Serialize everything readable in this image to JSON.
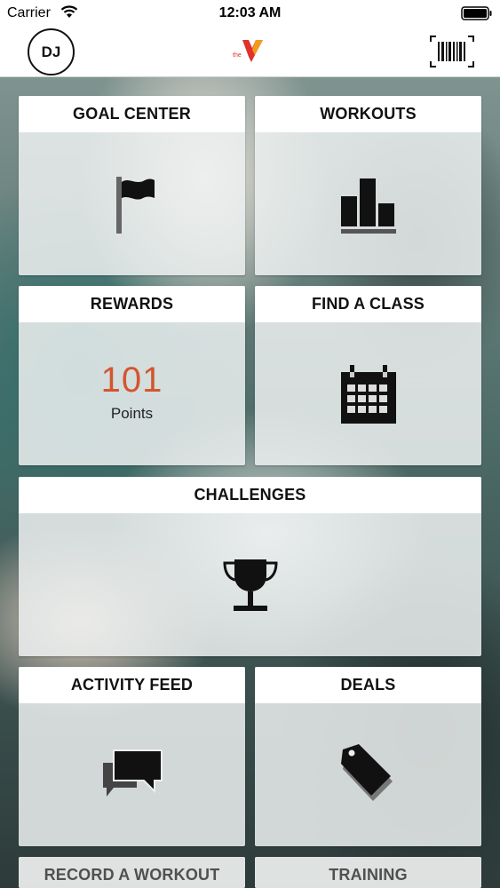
{
  "status_bar": {
    "carrier": "Carrier",
    "time": "12:03 AM",
    "icons": [
      "wifi-icon",
      "battery-icon"
    ]
  },
  "nav": {
    "avatar_initials": "DJ",
    "logo_text": "the",
    "icons": [
      "ymca-logo",
      "barcode-icon"
    ]
  },
  "tiles": {
    "goal_center": {
      "title": "GOAL CENTER",
      "icon": "flag-icon"
    },
    "workouts": {
      "title": "WORKOUTS",
      "icon": "bar-chart-icon"
    },
    "rewards": {
      "title": "REWARDS",
      "points_value": "101",
      "points_label": "Points"
    },
    "find_a_class": {
      "title": "FIND A CLASS",
      "icon": "calendar-icon"
    },
    "challenges": {
      "title": "CHALLENGES",
      "icon": "trophy-icon"
    },
    "activity_feed": {
      "title": "ACTIVITY FEED",
      "icon": "chat-bubbles-icon"
    },
    "deals": {
      "title": "DEALS",
      "icon": "price-tag-icon"
    },
    "record_a_workout": {
      "title": "RECORD A WORKOUT"
    },
    "training": {
      "title": "TRAINING"
    }
  },
  "colors": {
    "accent_points": "#d4552e",
    "logo_red": "#e0312a",
    "logo_orange": "#f39a1e",
    "tile_header_bg": "#ffffff",
    "icon_color": "#111111"
  }
}
